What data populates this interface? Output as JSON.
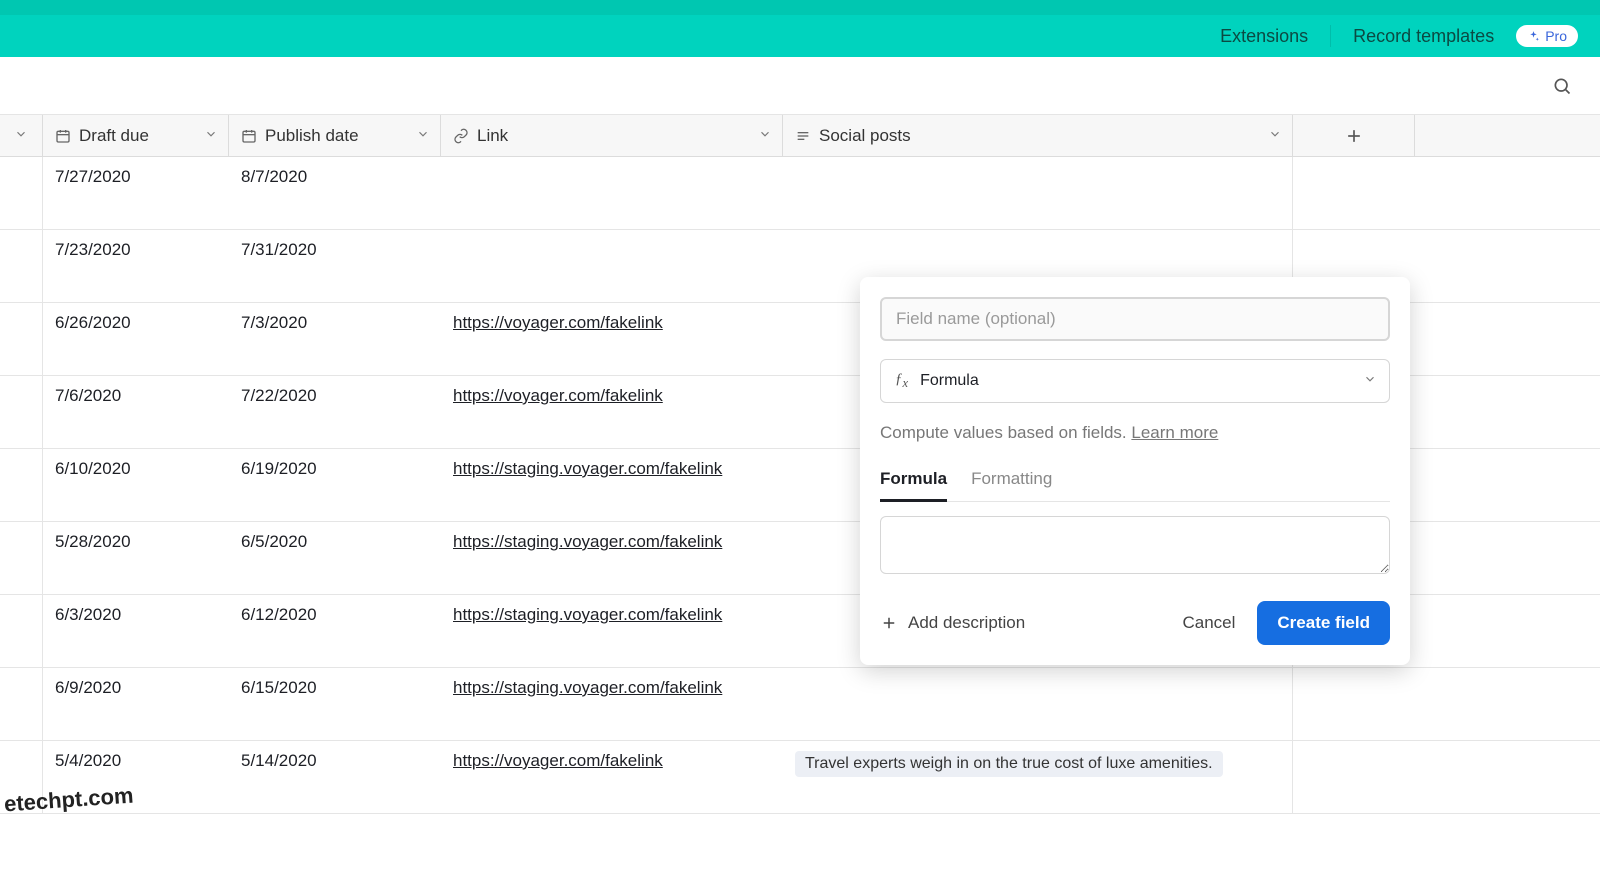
{
  "toolbar": {
    "extensions": "Extensions",
    "record_templates": "Record templates",
    "pro_label": "Pro"
  },
  "columns": {
    "draft_due": "Draft due",
    "publish_date": "Publish date",
    "link": "Link",
    "social_posts": "Social posts"
  },
  "rows": [
    {
      "draft_due": "7/27/2020",
      "publish_date": "8/7/2020",
      "link": "",
      "social": ""
    },
    {
      "draft_due": "7/23/2020",
      "publish_date": "7/31/2020",
      "link": "",
      "social": ""
    },
    {
      "draft_due": "6/26/2020",
      "publish_date": "7/3/2020",
      "link": "https://voyager.com/fakelink",
      "social": ""
    },
    {
      "draft_due": "7/6/2020",
      "publish_date": "7/22/2020",
      "link": "https://voyager.com/fakelink",
      "social": ""
    },
    {
      "draft_due": "6/10/2020",
      "publish_date": "6/19/2020",
      "link": "https://staging.voyager.com/fakelink",
      "social": ""
    },
    {
      "draft_due": "5/28/2020",
      "publish_date": "6/5/2020",
      "link": "https://staging.voyager.com/fakelink",
      "social": ""
    },
    {
      "draft_due": "6/3/2020",
      "publish_date": "6/12/2020",
      "link": "https://staging.voyager.com/fakelink",
      "social": ""
    },
    {
      "draft_due": "6/9/2020",
      "publish_date": "6/15/2020",
      "link": "https://staging.voyager.com/fakelink",
      "social": ""
    },
    {
      "draft_due": "5/4/2020",
      "publish_date": "5/14/2020",
      "link": "https://voyager.com/fakelink",
      "social": "Travel experts weigh in on the true cost of luxe amenities."
    }
  ],
  "popover": {
    "name_placeholder": "Field name (optional)",
    "type_label": "Formula",
    "helper_text": "Compute values based on fields. ",
    "learn_more": "Learn more",
    "tab_formula": "Formula",
    "tab_formatting": "Formatting",
    "add_description": "Add description",
    "cancel": "Cancel",
    "create": "Create field"
  },
  "watermark": "etechpt.com"
}
